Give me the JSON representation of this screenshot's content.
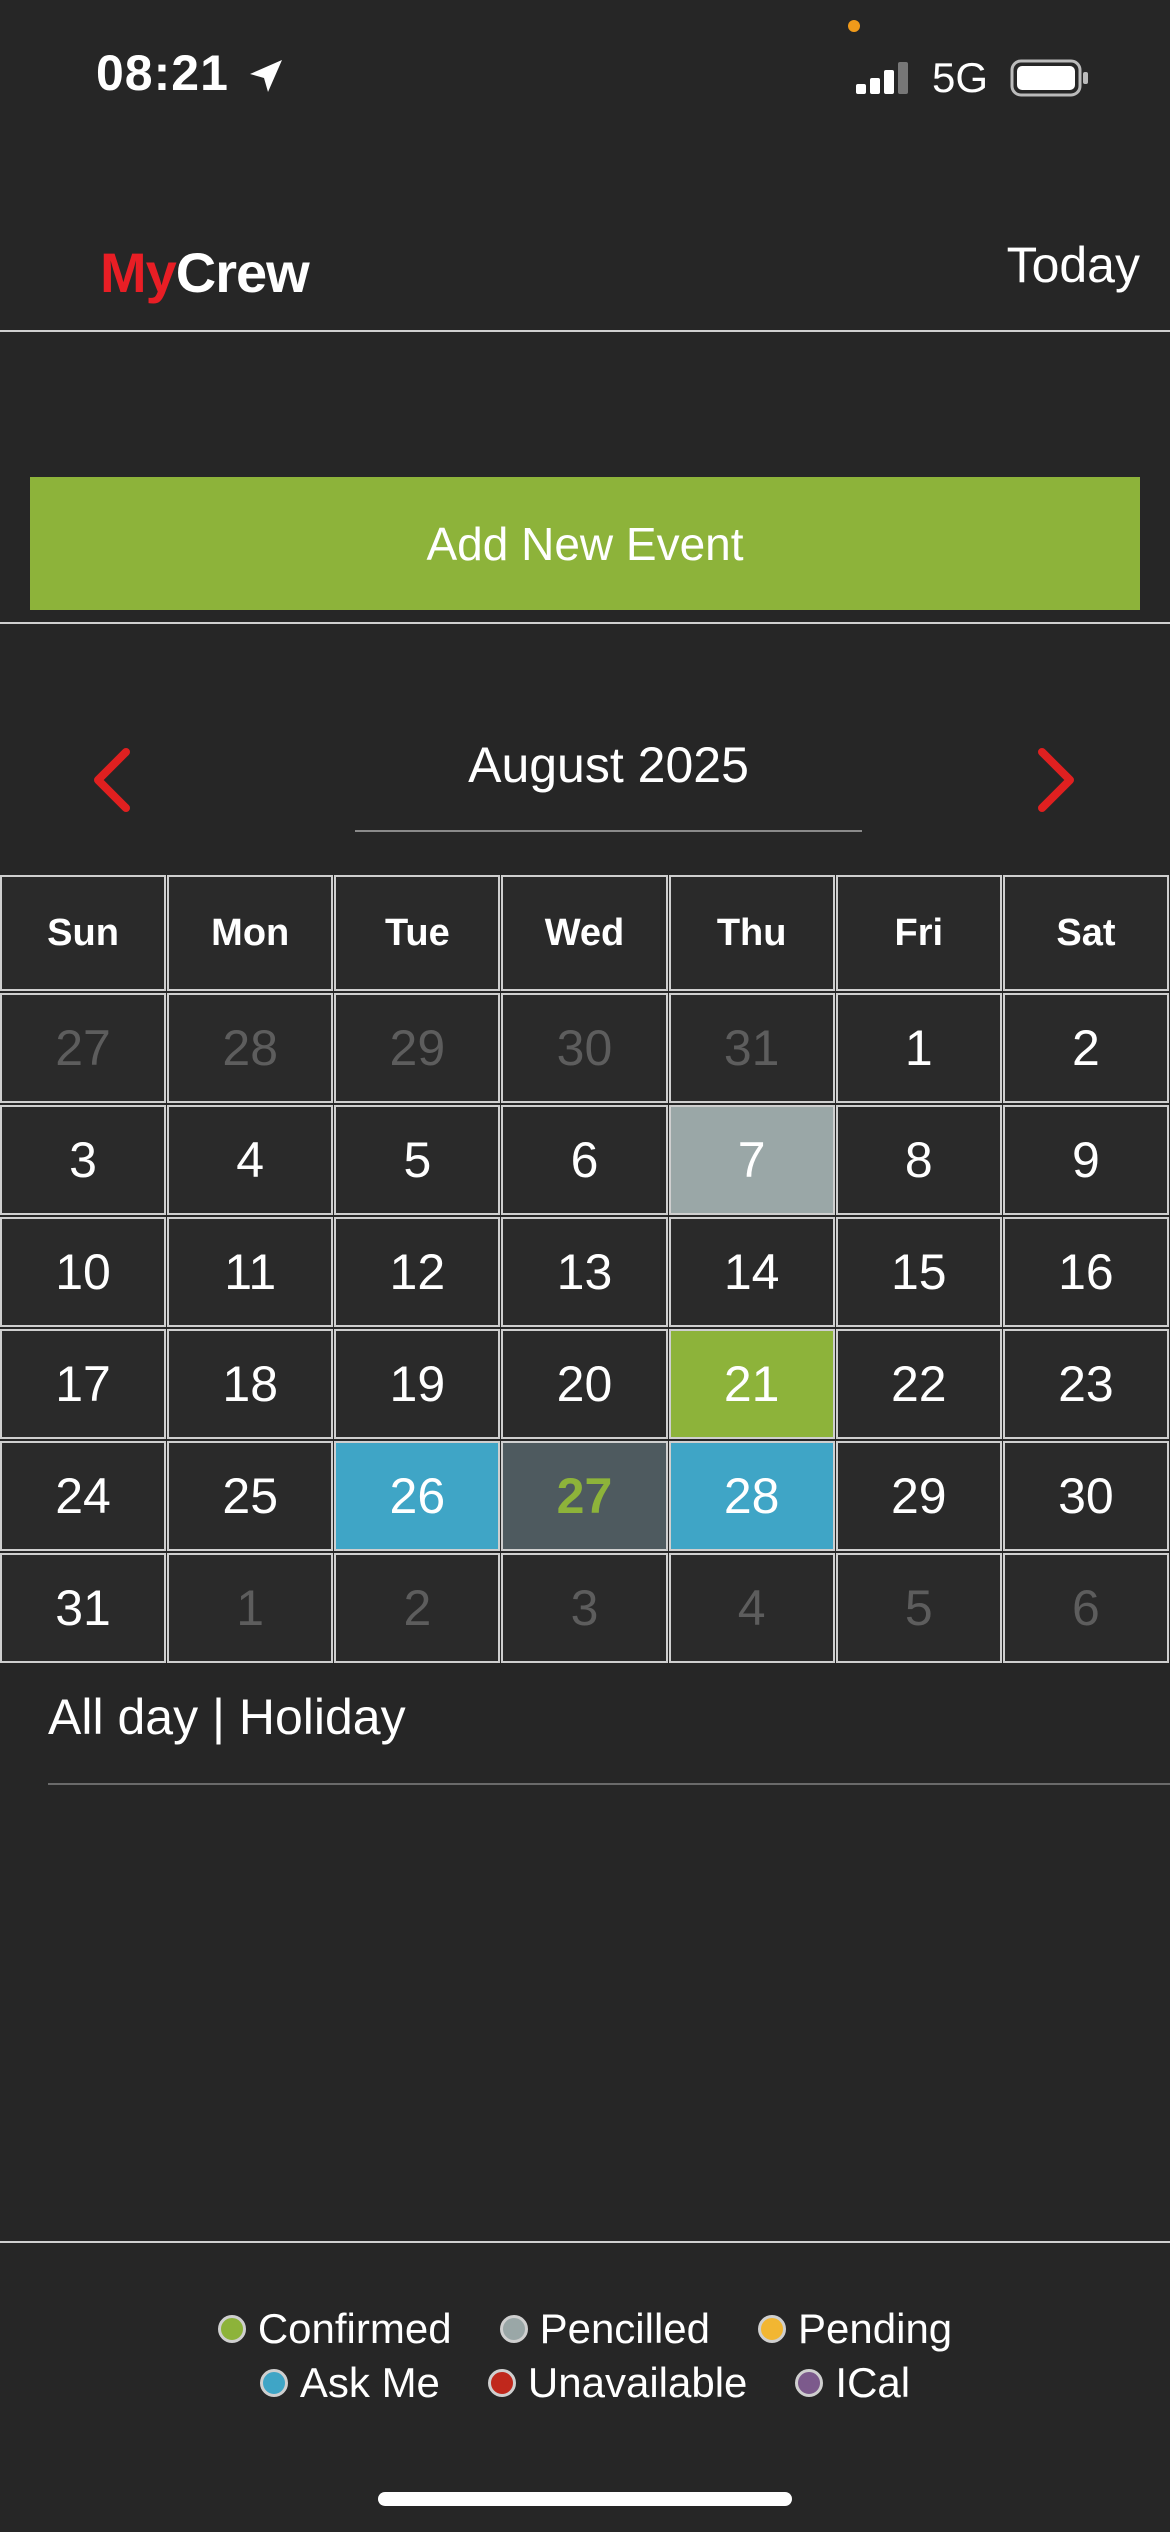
{
  "status_bar": {
    "time": "08:21",
    "network": "5G",
    "icons": [
      "location-arrow-icon",
      "signal-bars-icon",
      "battery-icon"
    ]
  },
  "header": {
    "logo_part1": "My",
    "logo_part2": "Crew",
    "today_label": "Today"
  },
  "add_event_label": "Add New Event",
  "calendar": {
    "month_title": "August 2025",
    "weekdays": [
      "Sun",
      "Mon",
      "Tue",
      "Wed",
      "Thu",
      "Fri",
      "Sat"
    ],
    "weeks": [
      [
        {
          "d": "27",
          "s": "muted"
        },
        {
          "d": "28",
          "s": "muted"
        },
        {
          "d": "29",
          "s": "muted"
        },
        {
          "d": "30",
          "s": "muted"
        },
        {
          "d": "31",
          "s": "muted"
        },
        {
          "d": "1",
          "s": ""
        },
        {
          "d": "2",
          "s": ""
        }
      ],
      [
        {
          "d": "3",
          "s": ""
        },
        {
          "d": "4",
          "s": ""
        },
        {
          "d": "5",
          "s": ""
        },
        {
          "d": "6",
          "s": ""
        },
        {
          "d": "7",
          "s": "pencilled"
        },
        {
          "d": "8",
          "s": ""
        },
        {
          "d": "9",
          "s": ""
        }
      ],
      [
        {
          "d": "10",
          "s": ""
        },
        {
          "d": "11",
          "s": ""
        },
        {
          "d": "12",
          "s": ""
        },
        {
          "d": "13",
          "s": ""
        },
        {
          "d": "14",
          "s": ""
        },
        {
          "d": "15",
          "s": ""
        },
        {
          "d": "16",
          "s": ""
        }
      ],
      [
        {
          "d": "17",
          "s": ""
        },
        {
          "d": "18",
          "s": ""
        },
        {
          "d": "19",
          "s": ""
        },
        {
          "d": "20",
          "s": ""
        },
        {
          "d": "21",
          "s": "confirmed"
        },
        {
          "d": "22",
          "s": ""
        },
        {
          "d": "23",
          "s": ""
        }
      ],
      [
        {
          "d": "24",
          "s": ""
        },
        {
          "d": "25",
          "s": ""
        },
        {
          "d": "26",
          "s": "askme"
        },
        {
          "d": "27",
          "s": "today"
        },
        {
          "d": "28",
          "s": "askme"
        },
        {
          "d": "29",
          "s": ""
        },
        {
          "d": "30",
          "s": ""
        }
      ],
      [
        {
          "d": "31",
          "s": ""
        },
        {
          "d": "1",
          "s": "muted"
        },
        {
          "d": "2",
          "s": "muted"
        },
        {
          "d": "3",
          "s": "muted"
        },
        {
          "d": "4",
          "s": "muted"
        },
        {
          "d": "5",
          "s": "muted"
        },
        {
          "d": "6",
          "s": "muted"
        }
      ]
    ]
  },
  "selected_event": "All day | Holiday",
  "legend": {
    "row1": [
      {
        "label": "Confirmed",
        "color": "#8db33a"
      },
      {
        "label": "Pencilled",
        "color": "#9aa7a7"
      },
      {
        "label": "Pending",
        "color": "#f2b632"
      }
    ],
    "row2": [
      {
        "label": "Ask Me",
        "color": "#3fa5c6"
      },
      {
        "label": "Unavailable",
        "color": "#c0281c"
      },
      {
        "label": "ICal",
        "color": "#7c5a8c"
      }
    ]
  },
  "colors": {
    "accent_green": "#8db33a",
    "nav_red": "#e02020",
    "background": "#262626"
  }
}
